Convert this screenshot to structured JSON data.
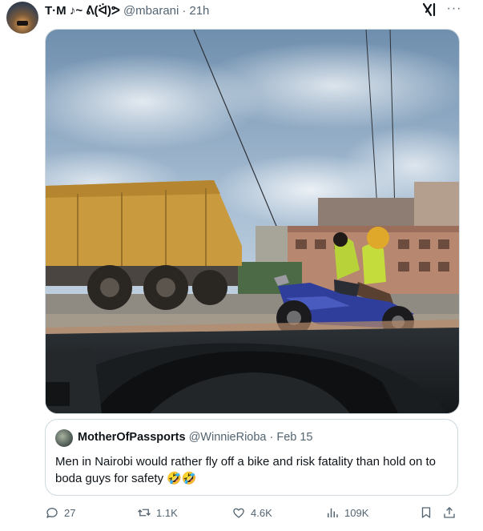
{
  "tweet": {
    "display_name": "T·M ♪~ ᕕ(ᐛ)ᕗ",
    "handle": "@mbarani",
    "separator": "·",
    "time": "21h",
    "more_label": "···"
  },
  "quote": {
    "display_name": "MotherOfPassports",
    "handle": "@WinnieRioba",
    "separator": "·",
    "date": "Feb 15",
    "text": "Men in Nairobi would rather fly off a bike and risk fatality than hold on to boda guys for safety 🤣🤣"
  },
  "actions": {
    "reply_count": "27",
    "repost_count": "1.1K",
    "like_count": "4.6K",
    "views_count": "109K"
  },
  "icons": [
    "grok-icon",
    "more-icon",
    "reply-icon",
    "repost-icon",
    "like-icon",
    "views-icon",
    "bookmark-icon",
    "share-icon"
  ],
  "colors": {
    "text": "#0f1419",
    "secondary": "#536471",
    "border": "#cfd9de"
  }
}
